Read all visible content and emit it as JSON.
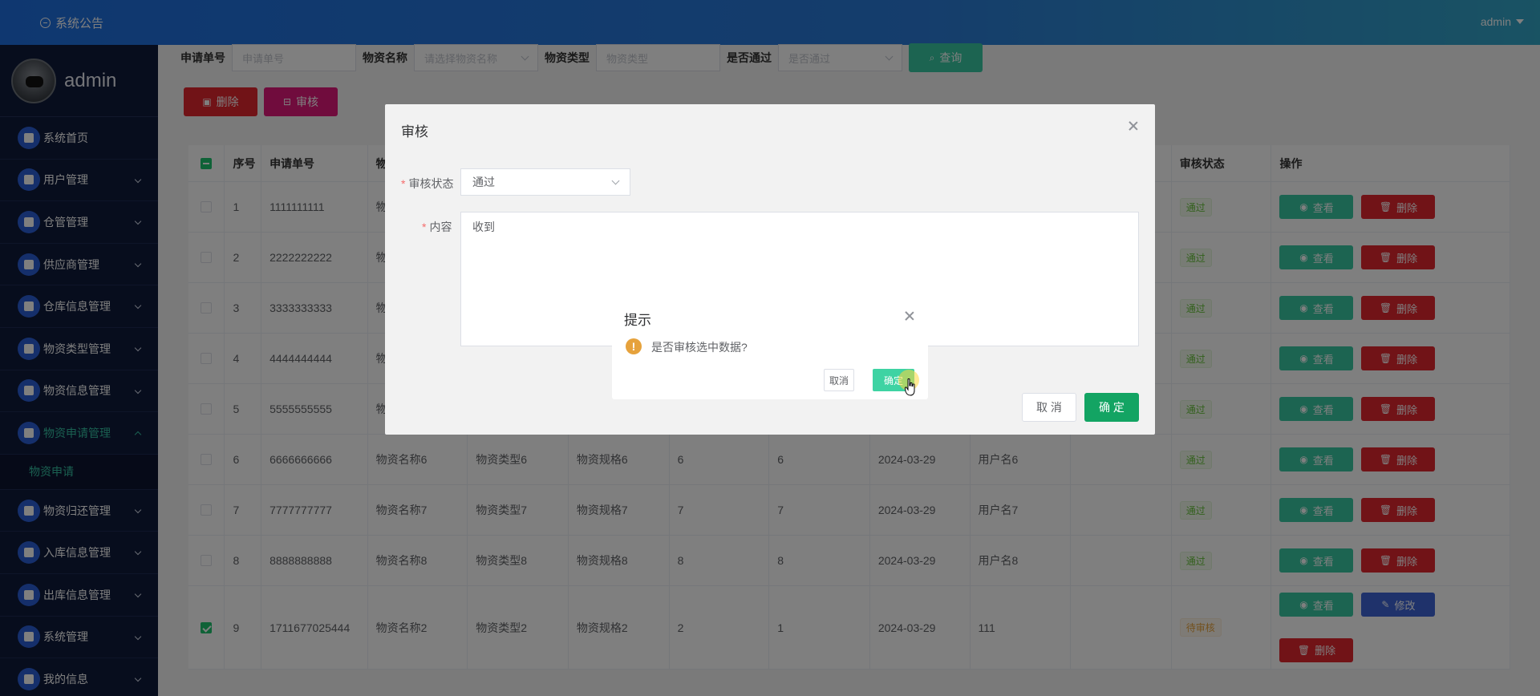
{
  "header": {
    "notice_label": "系统公告",
    "user_label": "admin"
  },
  "sidebar": {
    "profile_name": "admin",
    "items": [
      {
        "label": "系统首页",
        "has_children": false
      },
      {
        "label": "用户管理",
        "has_children": true
      },
      {
        "label": "仓管管理",
        "has_children": true
      },
      {
        "label": "供应商管理",
        "has_children": true
      },
      {
        "label": "仓库信息管理",
        "has_children": true
      },
      {
        "label": "物资类型管理",
        "has_children": true
      },
      {
        "label": "物资信息管理",
        "has_children": true
      },
      {
        "label": "物资申请管理",
        "has_children": true,
        "open": true
      },
      {
        "label": "物资归还管理",
        "has_children": true
      },
      {
        "label": "入库信息管理",
        "has_children": true
      },
      {
        "label": "出库信息管理",
        "has_children": true
      },
      {
        "label": "系统管理",
        "has_children": true
      },
      {
        "label": "我的信息",
        "has_children": true
      }
    ],
    "submenu": {
      "label": "物资申请"
    }
  },
  "search": {
    "order_label": "申请单号",
    "order_placeholder": "申请单号",
    "name_label": "物资名称",
    "name_placeholder": "请选择物资名称",
    "type_label": "物资类型",
    "type_placeholder": "物资类型",
    "pass_label": "是否通过",
    "pass_placeholder": "是否通过",
    "query_label": "查询"
  },
  "toolbar": {
    "delete_label": "删除",
    "audit_label": "审核"
  },
  "table": {
    "headers": [
      "序号",
      "申请单号",
      "物",
      "",
      "",
      "",
      "",
      "",
      "",
      "",
      "审核状态",
      "操作"
    ],
    "rows": [
      {
        "seq": "1",
        "order": "1111111111",
        "c3": "物",
        "c4": "",
        "c5": "",
        "c6": "",
        "c7": "",
        "c8": "",
        "c9": "",
        "c10": "",
        "status": "通过",
        "checked": false
      },
      {
        "seq": "2",
        "order": "2222222222",
        "c3": "物",
        "c4": "",
        "c5": "",
        "c6": "",
        "c7": "",
        "c8": "",
        "c9": "",
        "c10": "",
        "status": "通过",
        "checked": false
      },
      {
        "seq": "3",
        "order": "3333333333",
        "c3": "物",
        "c4": "",
        "c5": "",
        "c6": "",
        "c7": "",
        "c8": "",
        "c9": "",
        "c10": "",
        "status": "通过",
        "checked": false
      },
      {
        "seq": "4",
        "order": "4444444444",
        "c3": "物",
        "c4": "",
        "c5": "",
        "c6": "",
        "c7": "",
        "c8": "",
        "c9": "",
        "c10": "",
        "status": "通过",
        "checked": false
      },
      {
        "seq": "5",
        "order": "5555555555",
        "c3": "物",
        "c4": "",
        "c5": "",
        "c6": "",
        "c7": "",
        "c8": "",
        "c9": "",
        "c10": "",
        "status": "通过",
        "checked": false
      },
      {
        "seq": "6",
        "order": "6666666666",
        "c3": "物资名称6",
        "c4": "物资类型6",
        "c5": "物资规格6",
        "c6": "6",
        "c7": "6",
        "c8": "2024-03-29",
        "c9": "用户名6",
        "c10": "",
        "status": "通过",
        "checked": false
      },
      {
        "seq": "7",
        "order": "7777777777",
        "c3": "物资名称7",
        "c4": "物资类型7",
        "c5": "物资规格7",
        "c6": "7",
        "c7": "7",
        "c8": "2024-03-29",
        "c9": "用户名7",
        "c10": "",
        "status": "通过",
        "checked": false
      },
      {
        "seq": "8",
        "order": "8888888888",
        "c3": "物资名称8",
        "c4": "物资类型8",
        "c5": "物资规格8",
        "c6": "8",
        "c7": "8",
        "c8": "2024-03-29",
        "c9": "用户名8",
        "c10": "",
        "status": "通过",
        "checked": false
      },
      {
        "seq": "9",
        "order": "1711677025444",
        "c3": "物资名称2",
        "c4": "物资类型2",
        "c5": "物资规格2",
        "c6": "2",
        "c7": "1",
        "c8": "2024-03-29",
        "c9": "111",
        "c10": "",
        "status": "待审核",
        "checked": true
      }
    ],
    "actions": {
      "view": "查看",
      "delete": "删除",
      "edit": "修改"
    }
  },
  "audit_dialog": {
    "title": "审核",
    "status_label": "审核状态",
    "status_value": "通过",
    "content_label": "内容",
    "content_value": "收到",
    "cancel_label": "取 消",
    "ok_label": "确 定"
  },
  "confirm_box": {
    "title": "提示",
    "message": "是否审核选中数据?",
    "cancel_label": "取消",
    "ok_label": "确定"
  },
  "colors": {
    "accent": "#38c9a3",
    "danger": "#e2262f",
    "audit": "#e0197b",
    "edit": "#3f64d6",
    "sidebar": "#0f1a3a"
  }
}
